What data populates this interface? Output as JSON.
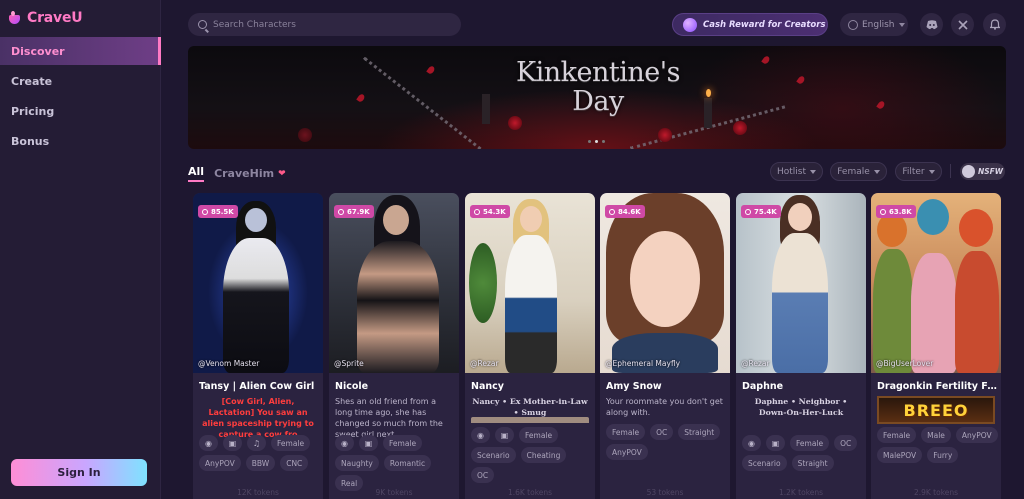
{
  "app": {
    "name": "CraveU"
  },
  "sidebar": {
    "items": [
      {
        "label": "Discover"
      },
      {
        "label": "Create"
      },
      {
        "label": "Pricing"
      },
      {
        "label": "Bonus"
      }
    ],
    "signin_label": "Sign In"
  },
  "header": {
    "search_placeholder": "Search Characters",
    "cash_label": "Cash Reward for Creators",
    "language": "English"
  },
  "banner": {
    "title_line1": "Kinkentine's",
    "title_line2": "Day"
  },
  "tabs": [
    {
      "label": "All"
    },
    {
      "label": "CraveHim"
    }
  ],
  "filters": {
    "hotlist": "Hotlist",
    "gender": "Female",
    "filter": "Filter",
    "nsfw": "NSFW"
  },
  "cards": [
    {
      "badge": "85.5K",
      "creator": "@Venom Master",
      "name": "Tansy | Alien Cow Girl",
      "desc": "[Cow Girl, Alien, Lactation] You saw an alien spaceship trying to capture a cow fro",
      "tags_row1": [
        "Female"
      ],
      "tags_row2": [
        "AnyPOV",
        "BBW",
        "CNC"
      ],
      "tokens": "12K tokens"
    },
    {
      "badge": "67.9K",
      "creator": "@Sprite",
      "name": "Nicole",
      "desc": "Shes an old friend from a long time ago, she has changed so much from the sweet girl next...",
      "tags_row1": [
        "Female"
      ],
      "tags_row2": [
        "Naughty",
        "Romantic",
        "Real"
      ],
      "tokens": "9K tokens"
    },
    {
      "badge": "54.3K",
      "creator": "@Rezar",
      "name": "Nancy",
      "desc": "Nancy • Ex Mother-in-Law • Smug",
      "tags_row1": [
        "Female"
      ],
      "tags_row2": [
        "Scenario",
        "Cheating",
        "OC"
      ],
      "tokens": "1.6K tokens"
    },
    {
      "badge": "84.6K",
      "creator": "@Ephemeral Mayfly",
      "name": "Amy Snow",
      "desc": "Your roommate you don't get along with.",
      "tags_row1": [
        "Female",
        "OC",
        "Straight"
      ],
      "tags_row2": [
        "AnyPOV"
      ],
      "tokens": "53 tokens"
    },
    {
      "badge": "75.4K",
      "creator": "@Rezar",
      "name": "Daphne",
      "desc": "Daphne • Neighbor • Down-On-Her-Luck",
      "tags_row1": [
        "Female",
        "OC"
      ],
      "tags_row2": [
        "Scenario",
        "Straight"
      ],
      "tokens": "1.2K tokens"
    },
    {
      "badge": "63.8K",
      "creator": "@BigUserLover",
      "name": "Dragonkin Fertility Festi...",
      "desc": "BREEO",
      "tags_row1": [
        "Female",
        "Male",
        "AnyPOV"
      ],
      "tags_row2": [
        "MalePOV",
        "Furry"
      ],
      "tokens": "2.9K tokens"
    }
  ],
  "icons": {
    "logo": "craveu-logo-icon",
    "search": "search-icon",
    "coin": "coin-icon",
    "globe": "globe-icon",
    "discord": "discord-icon",
    "x": "x-icon",
    "bell": "bell-icon",
    "chat": "chat-icon",
    "image": "image-icon",
    "music": "music-icon",
    "heart": "heart-icon"
  },
  "colors": {
    "accent": "#ff7ac5",
    "badge": "#cf49a6",
    "background": "#1e1730",
    "sidebar": "#241c35"
  }
}
